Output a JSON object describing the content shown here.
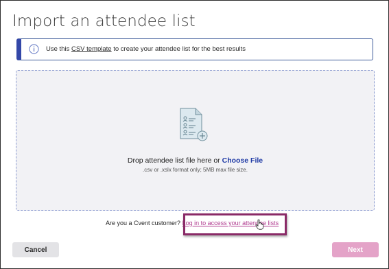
{
  "dialog": {
    "title": "Import an attendee list"
  },
  "info_banner": {
    "prefix": "Use this ",
    "link_text": "CSV template",
    "suffix": " to create your attendee list for the best results",
    "icon": "info-icon"
  },
  "dropzone": {
    "icon": "attendee-file-add-icon",
    "drop_text": "Drop attendee list file here or ",
    "choose_file": "Choose File",
    "format_text": ".csv or .xslx format only; 5MB max file size."
  },
  "login": {
    "question": "Are you a Cvent customer? ",
    "link_text": "Log in to access your attendee lists"
  },
  "buttons": {
    "cancel": "Cancel",
    "next": "Next"
  },
  "colors": {
    "accent_blue": "#3347a8",
    "link_pink": "#b03a8f",
    "highlight": "#8a2a67",
    "next_disabled": "#e4a3c8"
  }
}
